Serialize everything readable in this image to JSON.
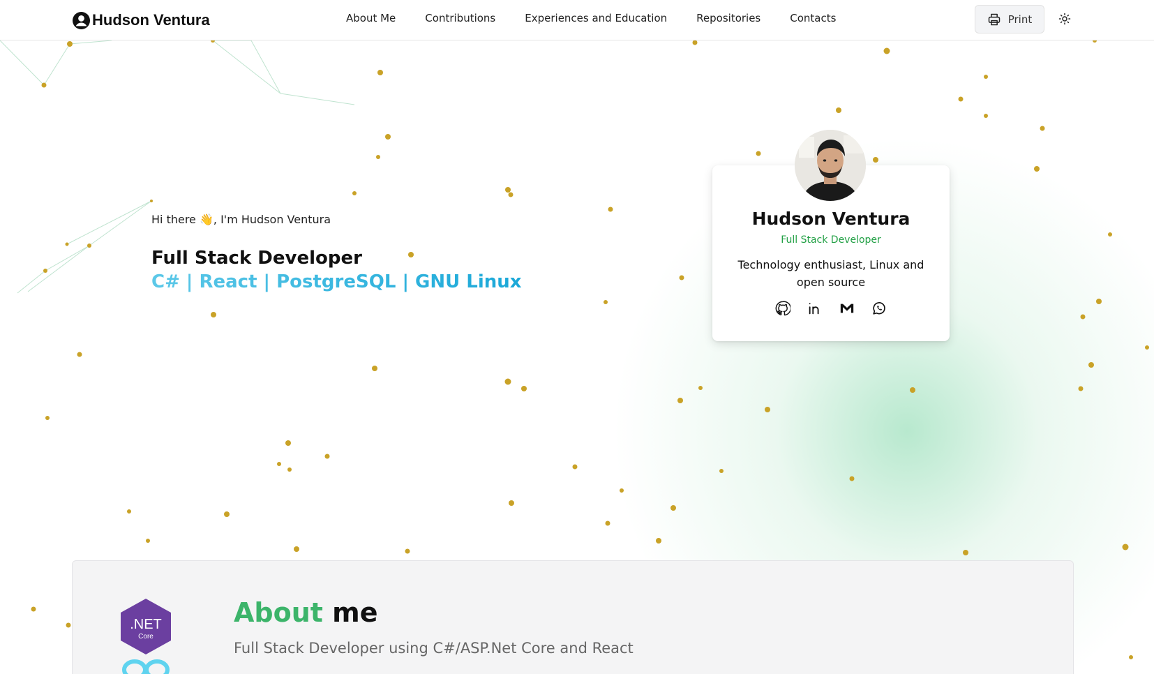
{
  "header": {
    "brand": "Hudson Ventura",
    "nav": [
      "About Me",
      "Contributions",
      "Experiences and Education",
      "Repositories",
      "Contacts"
    ],
    "print_label": "Print"
  },
  "hero": {
    "greeting": "Hi there 👋, I'm Hudson Ventura",
    "role": "Full Stack Developer",
    "stack": "C# | React | PostgreSQL | GNU Linux"
  },
  "card": {
    "name": "Hudson Ventura",
    "role": "Full Stack Developer",
    "bio": "Technology enthusiast, Linux and open source",
    "social": [
      "github-icon",
      "linkedin-icon",
      "gmail-icon",
      "whatsapp-icon"
    ]
  },
  "about": {
    "title_accent": "About",
    "title_rest": "me",
    "subtitle": "Full Stack Developer using C#/ASP.Net Core and React",
    "logo_text": ".NET",
    "logo_subtext": "Core"
  },
  "colors": {
    "accent_green": "#22a045",
    "stack_blue": "#1ba8d8",
    "dotnet_purple": "#6b3fa0",
    "particle_gold": "#c9a227"
  }
}
